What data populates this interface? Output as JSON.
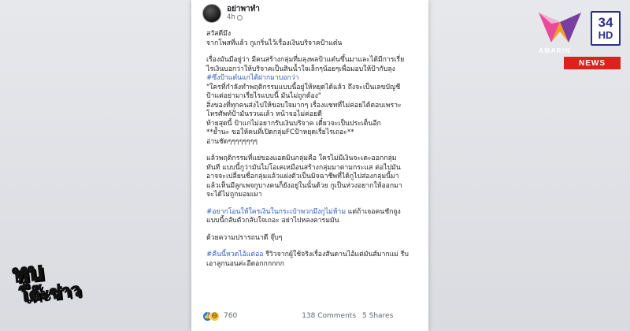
{
  "post": {
    "author": "อย่าพาทำ",
    "time": "4h",
    "body": [
      {
        "type": "text",
        "text": "สวัสดีมึง"
      },
      {
        "type": "text",
        "text": "จากโพสที่แล้ว กูเกริ่นไว้เรื่องเงินบริจาคป้าแต๋น"
      },
      {
        "type": "gap"
      },
      {
        "type": "text",
        "text": "เรื่องมันมีอยู่ว่า มีคนสร้างกลุ่มที่มลุงพลป้าแต๋นขึ้นมาและได้มีการเรี่ย"
      },
      {
        "type": "text",
        "text": "ไรเงินบอกว่าให้บริจาคเป็นสินน้ำใจเล็กๆน้อยๆเพื่อมอบให้ป้ากับลุง"
      },
      {
        "type": "hashtag",
        "text": "#ซึ่งป้าแต๋นแกได้ฝากมาบอกว่า"
      },
      {
        "type": "text",
        "text": "\"ใครที่กำลังทำพฤติกรรมแบบนี้อยู่ให้หยุดได้แล้ว ถึงจะเป็นเลขบัญชี"
      },
      {
        "type": "text",
        "text": "ป้าแต่อย่ามาเรี่ยไรแบบนี้ มันไม่ถูกต้อง\""
      },
      {
        "type": "text",
        "text": "สิ่งของที่ทุกคนส่งไปให้ขอบใจมากๆ เรื่องแชทที่ไม่ค่อยได้ตอบเพราะ"
      },
      {
        "type": "text",
        "text": "โทรศัพท์ป้ามันรวนแล้ว หน้าจอไม่ค่อยดี"
      },
      {
        "type": "text",
        "text": "ท้ายสุดนี้ ป้าแกไม่อยากรับเงินบริจาค เดี๋ยวจะเป็นประเด็นอีก"
      },
      {
        "type": "text",
        "text": "**ย้ำนะ ขอให้คนที่เปิดกลุ่มFCป้าหยุดเรี่ยไรเถอะ**"
      },
      {
        "type": "text",
        "text": "อ่านชัดๆๆๆๆๆๆๆๆ"
      },
      {
        "type": "gap"
      },
      {
        "type": "text",
        "text": "แล้วพฤติกรรมที่แย่ของแอดมินกลุ่มคือ ใครไม่มีเงินจะเตะออกกลุ่ม"
      },
      {
        "type": "text",
        "text": "ทันที แบบนี้กูว่ามันไม่โอเคเหมือนสร้างกลุ่มมาตามกระแส ต่อไปมัน"
      },
      {
        "type": "text",
        "text": "อาจจะเปลี่ยนชื่อกลุ่มแล้วแฝงตัวเป็นมิจฉาชีพที่ได้กูไปส่องกลุ่มนี้มา"
      },
      {
        "type": "text",
        "text": "แล้วเห็นมีลูกเพจกูบางคนก็ยังอยู่ในนั้นด้วย กูเป็นห่วงอยากให้ออกมา"
      },
      {
        "type": "text",
        "text": "จะได้ไม่ถูกมอมเมา"
      },
      {
        "type": "gap"
      },
      {
        "type": "mixed",
        "hashtag": "#อยากโอนให้ใครเงินในกระเป๋าพวกมึงกูไม่ห้าม",
        "text": " แต่ถ้าเจอคนชักจูง"
      },
      {
        "type": "text",
        "text": "แบบนี้กลับตัวกลับใจเถอะ อย่าไปหลงคารมมัน"
      },
      {
        "type": "gap"
      },
      {
        "type": "text",
        "text": "ด้วยความปรารถนาดี จุ๊บๆ"
      },
      {
        "type": "gap"
      },
      {
        "type": "mixed",
        "hashtag": "#คืนนี้หวดไอ้แต่อ่อ",
        "text": " รีวิวจากผู้ใช้จริงเรื่องสันดานไอ้แต่มันส์มากแม่ รีบ"
      },
      {
        "type": "text",
        "text": "เอาลูกนอนค่ะอีตอกกกกกก"
      }
    ],
    "footer": {
      "reaction_count": "760",
      "comments": "138 Comments",
      "shares": "5 Shares"
    }
  },
  "branding": {
    "channel_number": "34",
    "channel_hd": "HD",
    "network": "AMARIN",
    "news_badge": "NEWS",
    "show_line1": "ทุบ",
    "show_line2": "โต๊ะข่าว",
    "colors": {
      "channel_blue": "#2b2f8a",
      "news_red": "#d9241c",
      "amarin_pink": "#e84b9a",
      "amarin_orange": "#f3a021",
      "amarin_purple": "#7a3ea1",
      "hashtag_blue": "#2d5fbd"
    }
  },
  "icons": [
    "avatar",
    "globe-icon",
    "like-icon",
    "haha-icon",
    "amarin-logo"
  ]
}
